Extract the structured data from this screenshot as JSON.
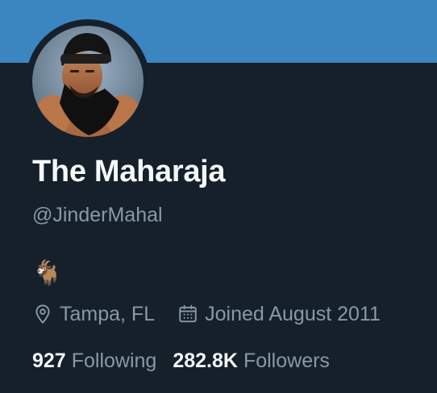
{
  "profile": {
    "name": "The Maharaja",
    "handle": "@JinderMahal",
    "bio": "🐐",
    "location": "Tampa, FL",
    "joined": "Joined August 2011",
    "following_count": "927",
    "following_label": "Following",
    "followers_count": "282.8K",
    "followers_label": "Followers"
  },
  "icons": {
    "location": "location-pin-icon",
    "joined": "calendar-icon"
  },
  "colors": {
    "background": "#15202b",
    "banner": "#3b85c0",
    "primary_text": "#f5f8fa",
    "secondary_text": "#8899a6"
  }
}
